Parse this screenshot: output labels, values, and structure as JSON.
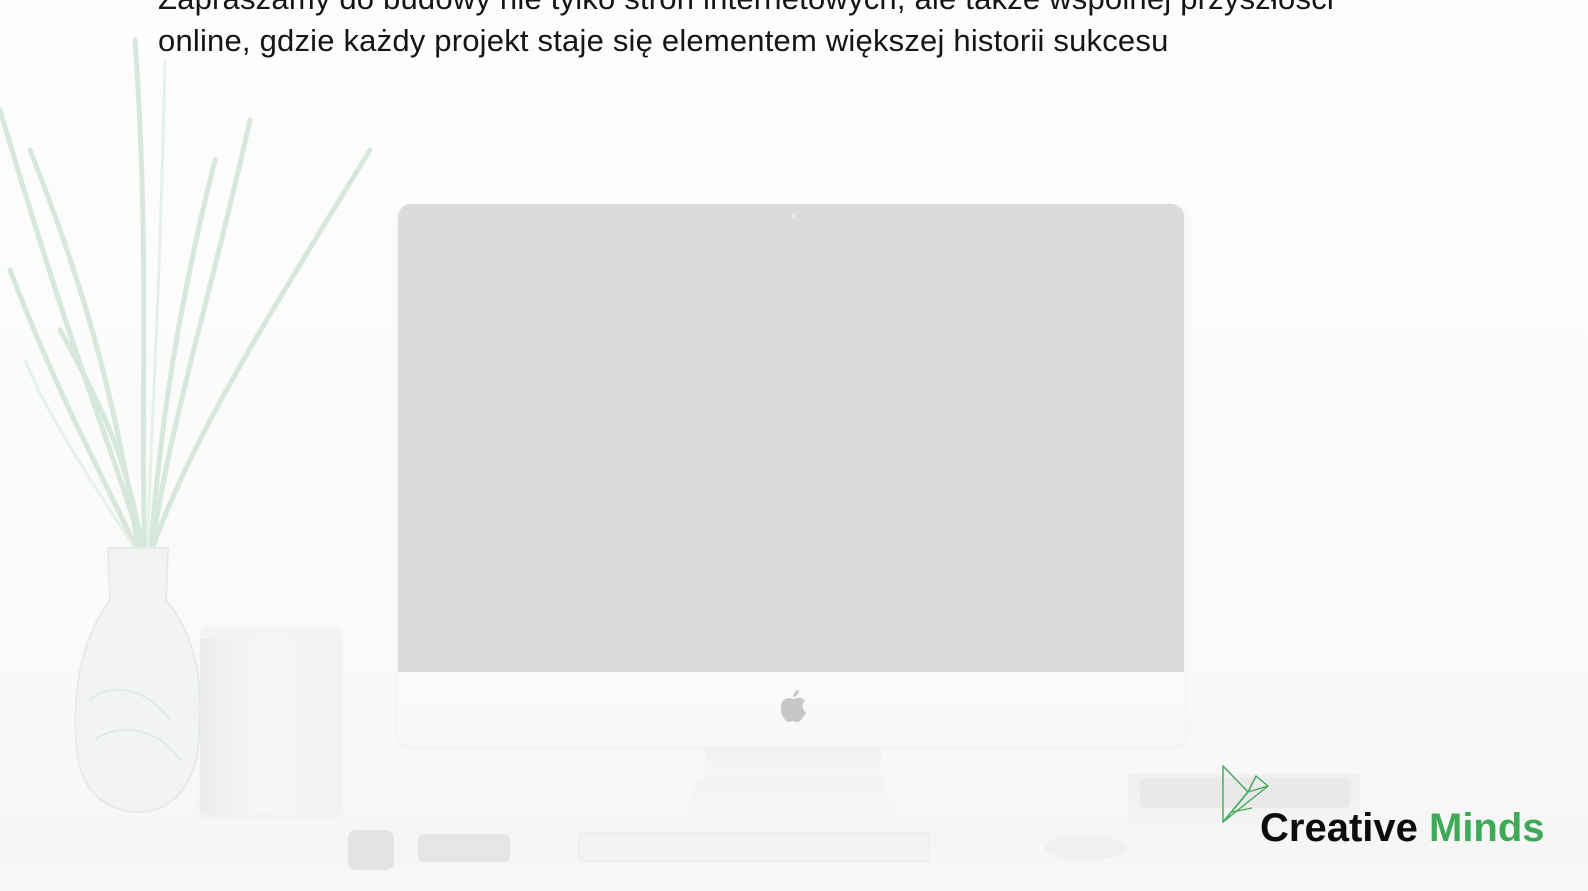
{
  "hero": {
    "line1": "Zapraszamy do budowy nie tylko stron internetowych, ale także wspólnej przyszłości",
    "line2": "online, gdzie każdy projekt staje się elementem większej historii sukcesu"
  },
  "brand": {
    "word1": "Creative",
    "word2": "Minds",
    "accent_color": "#3eaa57",
    "text_color": "#0c0c0c"
  },
  "icons": {
    "logo": "origami-bird-icon",
    "computer_logo": "apple-logo-icon"
  }
}
